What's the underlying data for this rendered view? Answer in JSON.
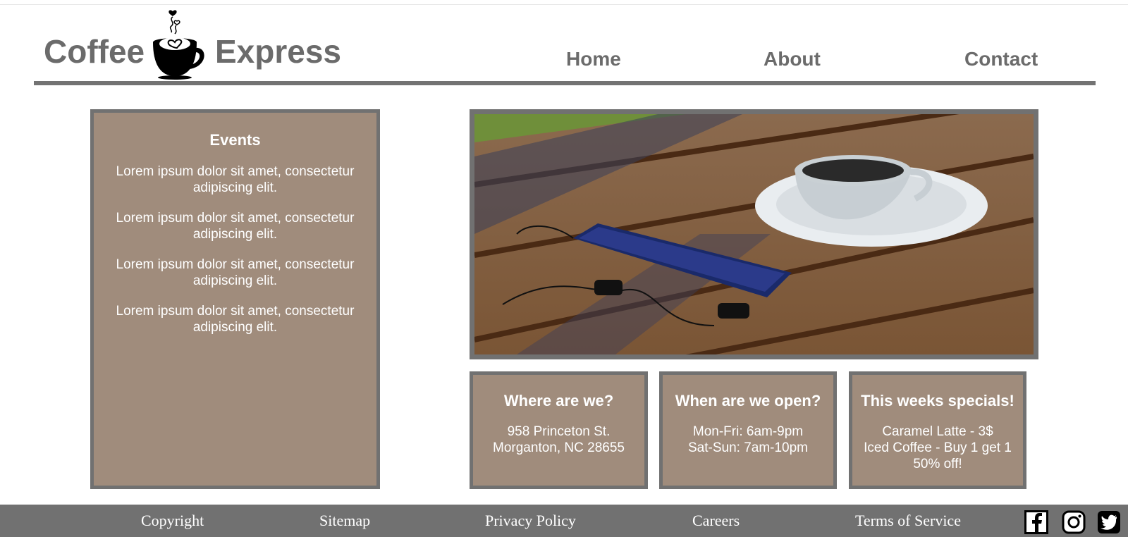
{
  "header": {
    "logo": {
      "word1": "Coffee",
      "word2": "Express",
      "icon": "coffee-cup-heart-icon"
    },
    "nav": [
      {
        "label": "Home"
      },
      {
        "label": "About"
      },
      {
        "label": "Contact"
      }
    ]
  },
  "events": {
    "title": "Events",
    "items": [
      "Lorem ipsum dolor sit amet, consectetur adipiscing elit.",
      "Lorem ipsum dolor sit amet, consectetur adipiscing elit.",
      "Lorem ipsum dolor sit amet, consectetur adipiscing elit.",
      "Lorem ipsum dolor sit amet, consectetur adipiscing elit."
    ]
  },
  "hero": {
    "image": "coffee-cup-phone-earbuds-on-wooden-table"
  },
  "info": {
    "where": {
      "title": "Where are we?",
      "lines": [
        "958 Princeton St.",
        "Morganton, NC 28655"
      ]
    },
    "when": {
      "title": "When are we open?",
      "lines": [
        "Mon-Fri: 6am-9pm",
        "Sat-Sun: 7am-10pm"
      ]
    },
    "specials": {
      "title": "This weeks specials!",
      "lines": [
        "Caramel Latte - 3$",
        "Iced Coffee - Buy 1 get 1 50% off!"
      ]
    }
  },
  "footer": {
    "links": [
      "Copyright",
      "Sitemap",
      "Privacy Policy",
      "Careers",
      "Terms of Service"
    ],
    "social": [
      "facebook-icon",
      "instagram-icon",
      "twitter-icon"
    ]
  },
  "colors": {
    "box_fill": "#a08c7c",
    "border_gray": "#717171",
    "text_gray": "#6b6b6b",
    "footer_bg": "#717171"
  }
}
